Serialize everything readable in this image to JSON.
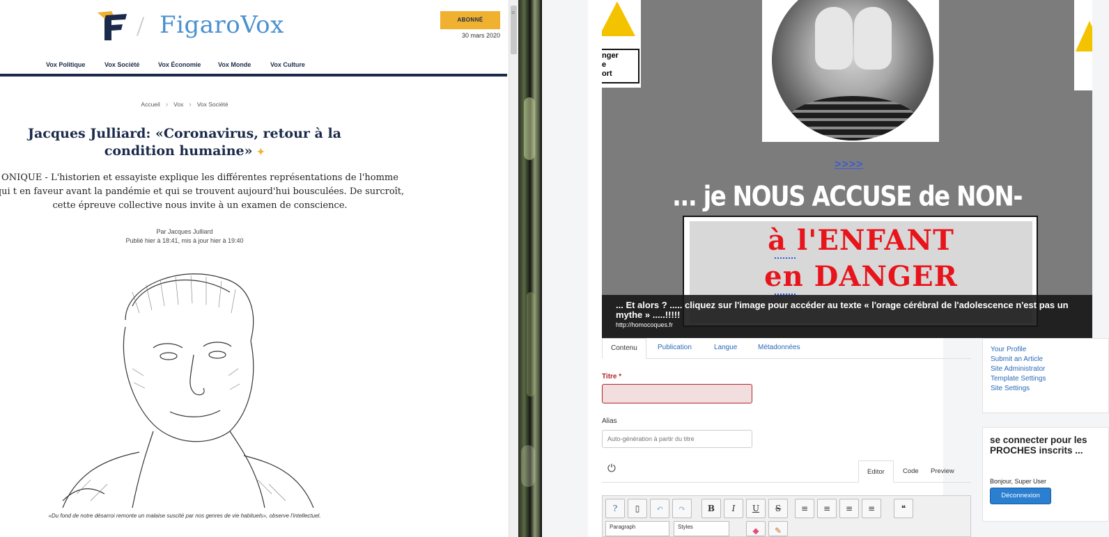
{
  "figaro": {
    "logo_text": "FigaroVox",
    "logo_separator": "/",
    "subscribe_button": "ABONNÉ",
    "date": "30 mars 2020",
    "nav": [
      "Vox Politique",
      "Vox Société",
      "Vox Économie",
      "Vox Monde",
      "Vox Culture"
    ],
    "breadcrumb": [
      "Accueil",
      "Vox",
      "Vox Société"
    ],
    "headline": "Jacques Julliard: «Coronavirus, retour à la condition humaine»",
    "chapo": "ONIQUE - L'historien et essayiste explique les différentes représentations de l'homme qui t en faveur avant la pandémie et qui se trouvent aujourd'hui bousculées. De surcroît, cette épreuve collective nous invite à un examen de conscience.",
    "author": "Par Jacques Julliard",
    "published": "Publié hier à 18:41, mis à jour hier à 19:40",
    "caption": "«Du fond de notre désarroi remonte un malaise suscité par nos genres de vie habituels», observe l'intellectuel."
  },
  "hero": {
    "warning_left_text": "nger\ne\nort",
    "link_arrows": ">>>>",
    "accuse": "... je NOUS ACCUSE de NON-ASSISTANCE",
    "danger_line1": "à l'ENFANT",
    "danger_line2": "en DANGER",
    "caption": "... Et alors ? ..... cliquez sur l'image pour accéder au texte « l'orage cérébral de l'adolescence n'est pas un mythe » .....!!!!!",
    "url": "http://homocoques.fr"
  },
  "editor": {
    "tabs": [
      "Contenu",
      "Publication",
      "Langue",
      "Métadonnées"
    ],
    "active_tab": "Contenu",
    "title_label": "Titre *",
    "title_value": "",
    "alias_label": "Alias",
    "alias_placeholder": "Auto-génération à partir du titre",
    "editor_tabs": [
      "Editor",
      "Code",
      "Preview"
    ],
    "active_editor_tab": "Editor",
    "toolbar_buttons": [
      "help",
      "new-document",
      "undo",
      "redo",
      "B",
      "I",
      "U",
      "S",
      "align-justify",
      "align-center",
      "align-left",
      "align-right",
      "blockquote"
    ],
    "paragraph_select": "Paragraph",
    "styles_select": "Styles"
  },
  "sidebar": {
    "links": [
      "Your Profile",
      "Submit an Article",
      "Site Administrator",
      "Template Settings",
      "Site Settings"
    ],
    "login_heading": "se connecter pour les PROCHES inscrits ...",
    "greeting": "Bonjour, Super User",
    "logout_button": "Déconnexion"
  },
  "colors": {
    "figaro_navy": "#1b2a4a",
    "figaro_blue": "#4a90cf",
    "figaro_gold": "#f0b030",
    "danger_red": "#e8141b",
    "joomla_link": "#2a69b8",
    "error_red": "#b0252a"
  }
}
